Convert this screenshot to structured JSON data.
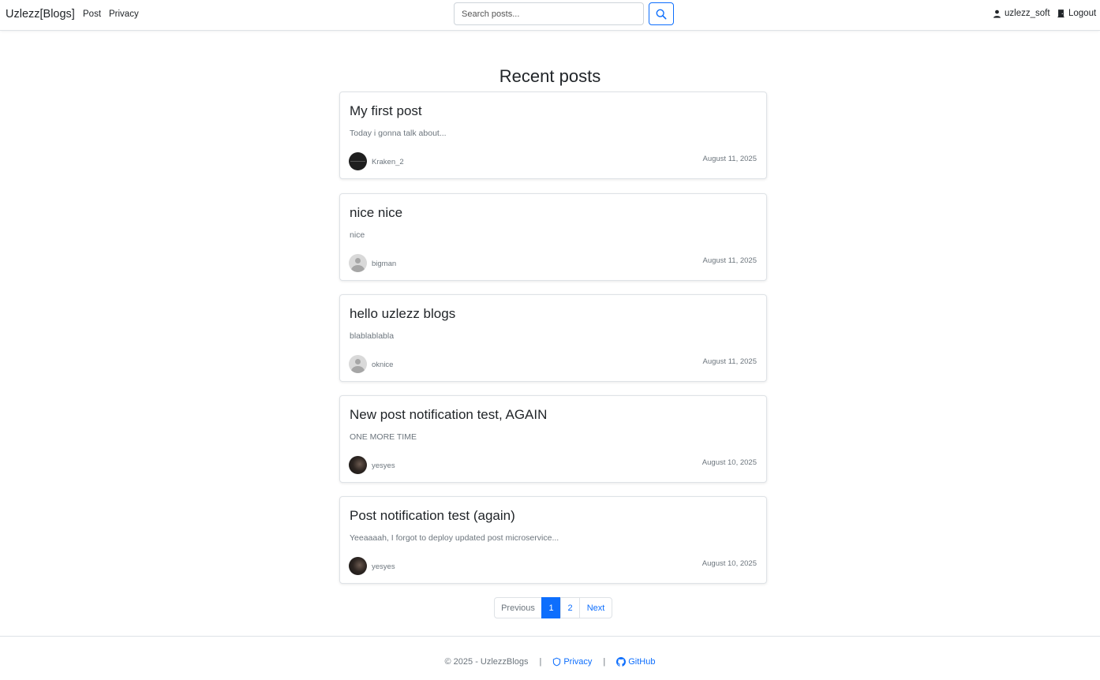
{
  "navbar": {
    "brand": "Uzlezz[Blogs]",
    "links": [
      "Post",
      "Privacy"
    ],
    "search_placeholder": "Search posts...",
    "search_icon": "search-icon",
    "username": "uzlezz_soft",
    "logout_label": "Logout"
  },
  "main": {
    "title": "Recent posts",
    "posts": [
      {
        "title": "My first post",
        "excerpt": "Today i gonna talk about...",
        "author": "Kraken_2",
        "date": "August 11, 2025",
        "avatar": "dark"
      },
      {
        "title": "nice nice",
        "excerpt": "nice",
        "author": "bigman",
        "date": "August 11, 2025",
        "avatar": "default"
      },
      {
        "title": "hello uzlezz blogs",
        "excerpt": "blablablabla",
        "author": "oknice",
        "date": "August 11, 2025",
        "avatar": "default"
      },
      {
        "title": "New post notification test, AGAIN",
        "excerpt": "ONE MORE TIME",
        "author": "yesyes",
        "date": "August 10, 2025",
        "avatar": "photo"
      },
      {
        "title": "Post notification test (again)",
        "excerpt": "Yeeaaaah, I forgot to deploy updated post microservice...",
        "author": "yesyes",
        "date": "August 10, 2025",
        "avatar": "photo"
      }
    ]
  },
  "pagination": {
    "previous": "Previous",
    "pages": [
      "1",
      "2"
    ],
    "active_page": "1",
    "next": "Next"
  },
  "footer": {
    "copyright": "© 2025 - UzlezzBlogs",
    "separator": "|",
    "privacy": "Privacy",
    "github": "GitHub"
  },
  "colors": {
    "accent": "#0d6efd",
    "muted": "#6c757d",
    "border": "#dee2e6"
  }
}
